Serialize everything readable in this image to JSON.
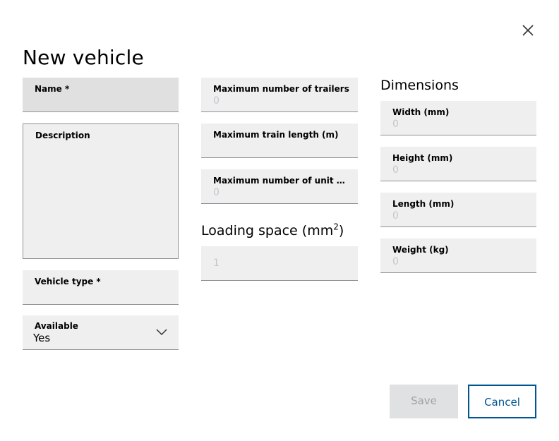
{
  "dialog": {
    "title": "New vehicle",
    "close_icon": "close-icon"
  },
  "column1": {
    "name": {
      "label": "Name *",
      "value": ""
    },
    "description": {
      "label": "Description",
      "value": ""
    },
    "vehicle_type": {
      "label": "Vehicle type *",
      "value": ""
    },
    "available": {
      "label": "Available",
      "selected": "Yes",
      "icon": "chevron-down-icon"
    }
  },
  "column2": {
    "max_trailers": {
      "label": "Maximum number of trailers",
      "placeholder": "0"
    },
    "max_train_length": {
      "label": "Maximum train length (m)",
      "placeholder": ""
    },
    "max_unit_loads": {
      "label": "Maximum number of unit loa...",
      "placeholder": "0"
    },
    "loading_space": {
      "heading": "Loading space (mm",
      "heading_sup": "2",
      "heading_end": ")",
      "placeholder": "1"
    }
  },
  "column3": {
    "heading": "Dimensions",
    "width": {
      "label": "Width (mm)",
      "placeholder": "0"
    },
    "height": {
      "label": "Height (mm)",
      "placeholder": "0"
    },
    "length": {
      "label": "Length (mm)",
      "placeholder": "0"
    },
    "weight": {
      "label": "Weight (kg)",
      "placeholder": "0"
    }
  },
  "actions": {
    "save_label": "Save",
    "cancel_label": "Cancel"
  },
  "colors": {
    "field_bg": "#efefef",
    "field_focused_bg": "#e0e0e0",
    "placeholder": "#c4c7ca",
    "primary": "#005691",
    "disabled_bg": "#e0e1e2",
    "disabled_text": "#9da3a8"
  }
}
